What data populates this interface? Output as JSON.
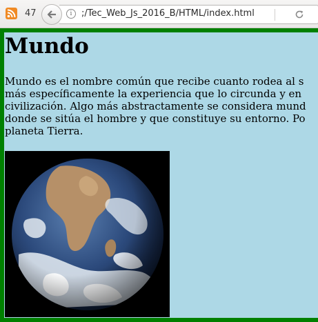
{
  "browser": {
    "feed_count": "47",
    "url": ";/Tec_Web_Js_2016_B/HTML/index.html",
    "icons": [
      "rss-icon",
      "back-arrow-icon",
      "info-icon",
      "reload-icon"
    ]
  },
  "page": {
    "heading": "Mundo",
    "paragraph": [
      "Mundo es el nombre común que recibe cuanto rodea al s",
      "más específicamente la experiencia que lo circunda y en",
      "civilización. Algo más abstractamente se considera mund",
      "donde se sitúa el hombre y que constituye su entorno. Po",
      "planeta Tierra."
    ],
    "image": "earth-photo",
    "colors": {
      "background": "#add8e6",
      "border": "#008000"
    }
  }
}
